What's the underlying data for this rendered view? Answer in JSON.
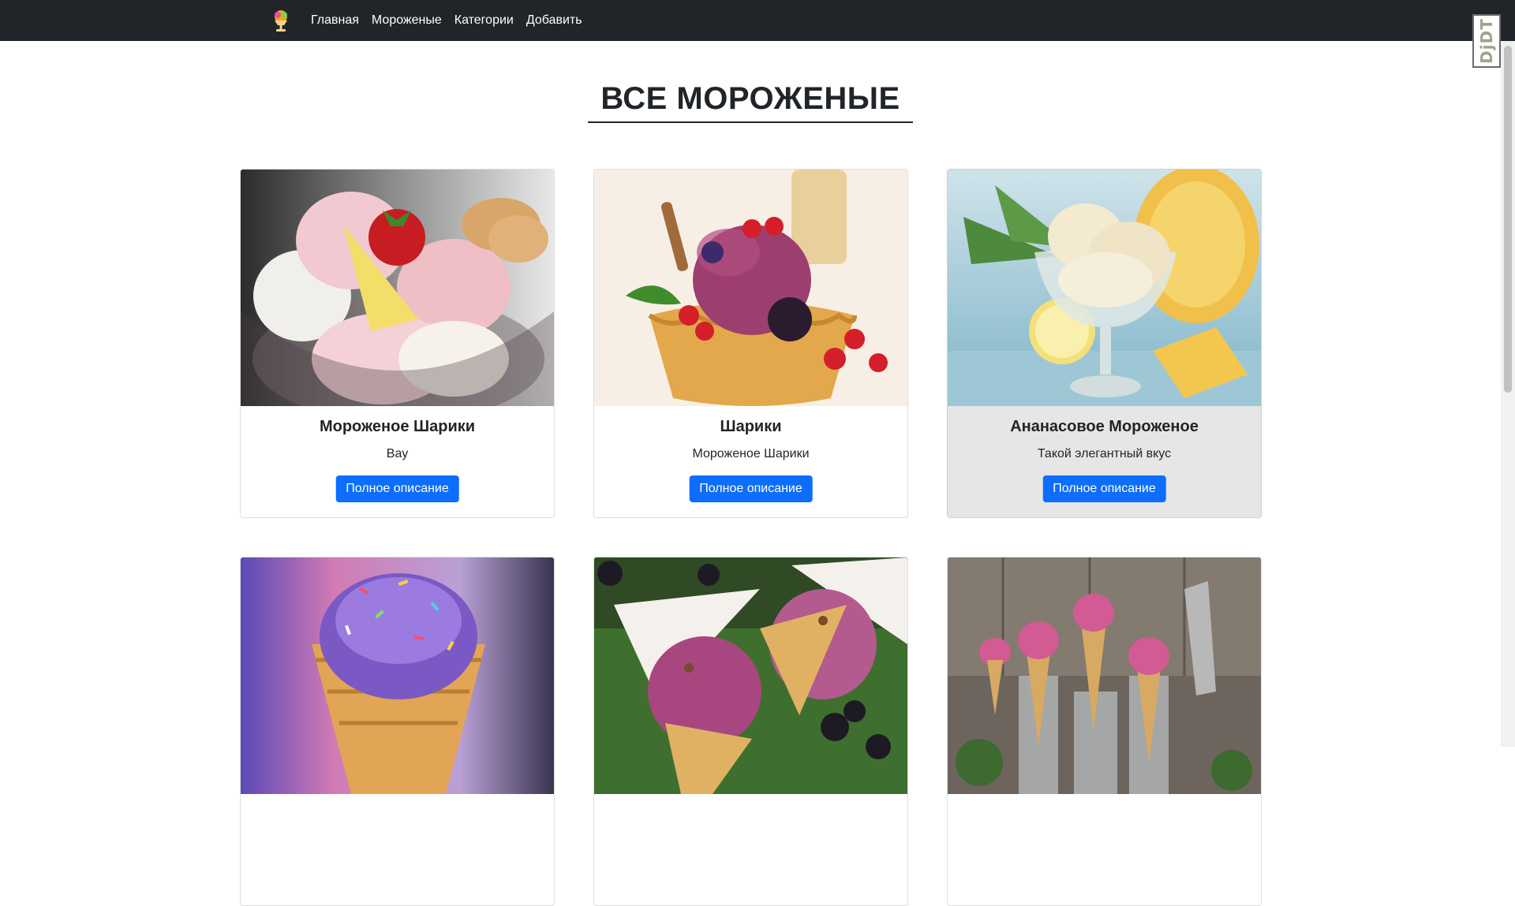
{
  "navbar": {
    "logo_icon": "ice-cream-icon",
    "links": [
      "Главная",
      "Мороженые",
      "Категории",
      "Добавить"
    ],
    "debug_toolbar_label": "DjDT"
  },
  "page": {
    "title": "ВСЕ МОРОЖЕНЫЕ"
  },
  "cards": [
    {
      "title": "Мороженое Шарики",
      "text": "Вау",
      "button": "Полное описание",
      "image": "scoops-in-glass-bowl-with-strawberry"
    },
    {
      "title": "Шарики",
      "text": "Мороженое Шарики",
      "button": "Полное описание",
      "image": "berry-scoop-in-waffle-basket"
    },
    {
      "title": "Ананасовое Мороженое",
      "text": "Такой элегантный вкус",
      "button": "Полное описание",
      "image": "pineapple-ice-cream-in-glass"
    },
    {
      "image": "sprinkles-cone"
    },
    {
      "image": "blackberry-waffle-cones"
    },
    {
      "image": "pink-cones-in-glasses"
    }
  ],
  "colors": {
    "navbar_bg": "#212529",
    "primary_button": "#0d6efd",
    "hover_card_bg": "#e6e6e6"
  }
}
